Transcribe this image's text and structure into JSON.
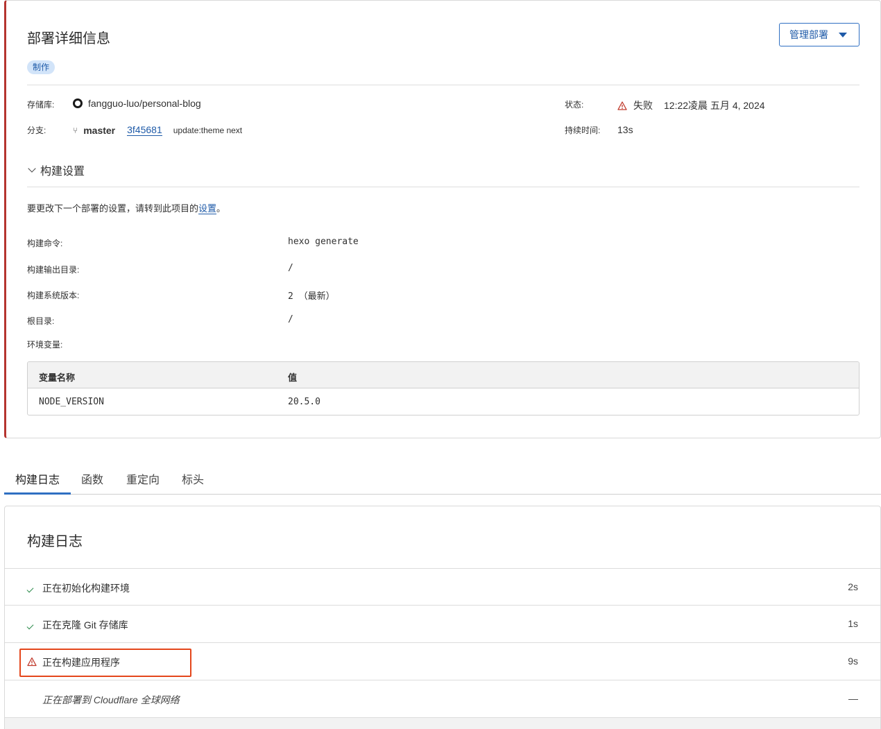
{
  "deployment": {
    "title": "部署详细信息",
    "env_badge": "制作",
    "manage_button": "管理部署",
    "repo_label": "存储库:",
    "repo_value": "fangguo-luo/personal-blog",
    "branch_label": "分支:",
    "branch_name": "master",
    "commit_hash": "3f45681",
    "commit_message": "update:theme next",
    "status_label": "状态:",
    "status_value": "失败",
    "status_time": "12:22凌晨 五月 4, 2024",
    "duration_label": "持续时间:",
    "duration_value": "13s"
  },
  "build_settings": {
    "toggle_label": "构建设置",
    "hint_text": "要更改下一个部署的设置，请转到此项目的",
    "hint_link": "设置",
    "hint_end": "。",
    "rows": [
      {
        "label": "构建命令:",
        "value": "hexo generate"
      },
      {
        "label": "构建输出目录:",
        "value": "/"
      },
      {
        "label": "构建系统版本:",
        "value": "2 （最新）"
      },
      {
        "label": "根目录:",
        "value": "/"
      }
    ],
    "env_label": "环境变量:",
    "env_table": {
      "col_name": "变量名称",
      "col_value": "值",
      "rows": [
        {
          "name": "NODE_VERSION",
          "value": "20.5.0"
        }
      ]
    }
  },
  "tabs": [
    {
      "label": "构建日志"
    },
    {
      "label": "函数"
    },
    {
      "label": "重定向"
    },
    {
      "label": "标头"
    }
  ],
  "build_log": {
    "title": "构建日志",
    "steps": [
      {
        "label": "正在初始化构建环境",
        "duration": "2s",
        "state": "success"
      },
      {
        "label": "正在克隆 Git 存储库",
        "duration": "1s",
        "state": "success"
      },
      {
        "label": "正在构建应用程序",
        "duration": "9s",
        "state": "failed"
      },
      {
        "label": "正在部署到 Cloudflare 全球网络",
        "duration": "—",
        "state": "pending"
      }
    ]
  },
  "colors": {
    "accent": "#2f6fc2",
    "failure": "#b5342f",
    "highlight": "#e4461b",
    "success": "#2a8a4a"
  }
}
